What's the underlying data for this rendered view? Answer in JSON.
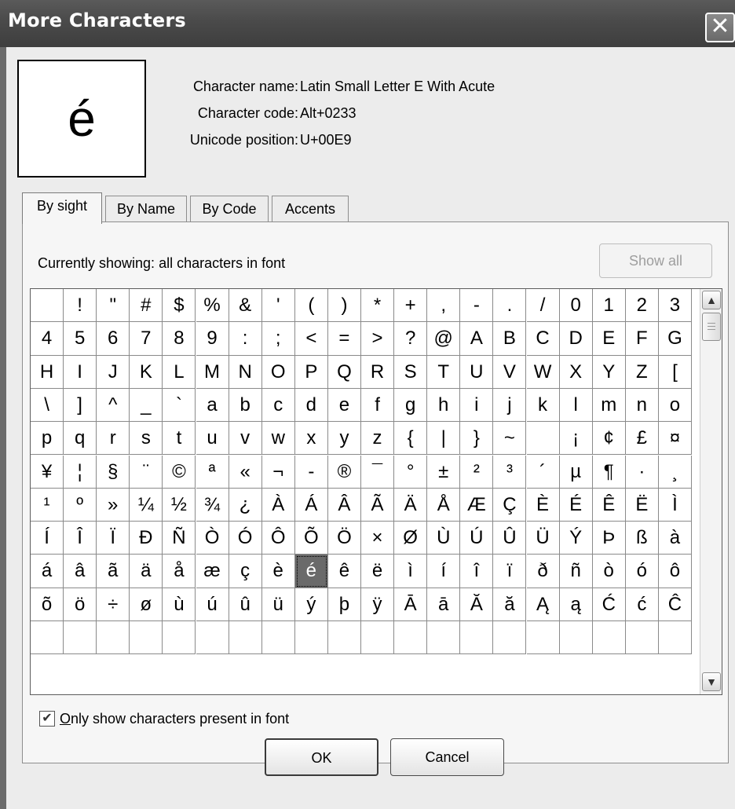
{
  "window": {
    "title": "More Characters",
    "close_glyph": "✕"
  },
  "preview": {
    "char": "é"
  },
  "info": {
    "name_label": "Character name:",
    "name_value": "Latin Small Letter E With Acute",
    "code_label": "Character code:",
    "code_value": "Alt+0233",
    "unicode_label": "Unicode position:",
    "unicode_value": "U+00E9"
  },
  "tabs": [
    "By sight",
    "By Name",
    "By Code",
    "Accents"
  ],
  "active_tab": "By sight",
  "showing_text": "Currently showing: all characters in font",
  "show_all_label": "Show all",
  "grid_rows": [
    [
      " ",
      "!",
      "\"",
      "#",
      "$",
      "%",
      "&",
      "'",
      "(",
      ")",
      "*",
      "+",
      ",",
      "-",
      ".",
      "/",
      "0",
      "1",
      "2",
      "3"
    ],
    [
      "4",
      "5",
      "6",
      "7",
      "8",
      "9",
      ":",
      ";",
      "<",
      "=",
      ">",
      "?",
      "@",
      "A",
      "B",
      "C",
      "D",
      "E",
      "F",
      "G"
    ],
    [
      "H",
      "I",
      "J",
      "K",
      "L",
      "M",
      "N",
      "O",
      "P",
      "Q",
      "R",
      "S",
      "T",
      "U",
      "V",
      "W",
      "X",
      "Y",
      "Z",
      "["
    ],
    [
      "\\",
      "]",
      "^",
      "_",
      "`",
      "a",
      "b",
      "c",
      "d",
      "e",
      "f",
      "g",
      "h",
      "i",
      "j",
      "k",
      "l",
      "m",
      "n",
      "o"
    ],
    [
      "p",
      "q",
      "r",
      "s",
      "t",
      "u",
      "v",
      "w",
      "x",
      "y",
      "z",
      "{",
      "|",
      "}",
      "~",
      " ",
      "¡",
      "¢",
      "£",
      "¤"
    ],
    [
      "¥",
      "¦",
      "§",
      "¨",
      "©",
      "ª",
      "«",
      "¬",
      "-",
      "®",
      "¯",
      "°",
      "±",
      "²",
      "³",
      "´",
      "µ",
      "¶",
      "·",
      "¸"
    ],
    [
      "¹",
      "º",
      "»",
      "¼",
      "½",
      "¾",
      "¿",
      "À",
      "Á",
      "Â",
      "Ã",
      "Ä",
      "Å",
      "Æ",
      "Ç",
      "È",
      "É",
      "Ê",
      "Ë",
      "Ì"
    ],
    [
      "Í",
      "Î",
      "Ï",
      "Ð",
      "Ñ",
      "Ò",
      "Ó",
      "Ô",
      "Õ",
      "Ö",
      "×",
      "Ø",
      "Ù",
      "Ú",
      "Û",
      "Ü",
      "Ý",
      "Þ",
      "ß",
      "à"
    ],
    [
      "á",
      "â",
      "ã",
      "ä",
      "å",
      "æ",
      "ç",
      "è",
      "é",
      "ê",
      "ë",
      "ì",
      "í",
      "î",
      "ï",
      "ð",
      "ñ",
      "ò",
      "ó",
      "ô"
    ],
    [
      "õ",
      "ö",
      "÷",
      "ø",
      "ù",
      "ú",
      "û",
      "ü",
      "ý",
      "þ",
      "ÿ",
      "Ā",
      "ā",
      "Ă",
      "ă",
      "Ą",
      "ą",
      "Ć",
      "ć",
      "Ĉ"
    ]
  ],
  "selected_char": "é",
  "checkbox": {
    "checked": true,
    "mnemonic": "O",
    "label_rest": "nly show characters present in font",
    "check_glyph": "✔"
  },
  "buttons": {
    "ok": "OK",
    "cancel": "Cancel"
  },
  "scrollbar": {
    "up_icon": "▲",
    "down_icon": "▼"
  }
}
